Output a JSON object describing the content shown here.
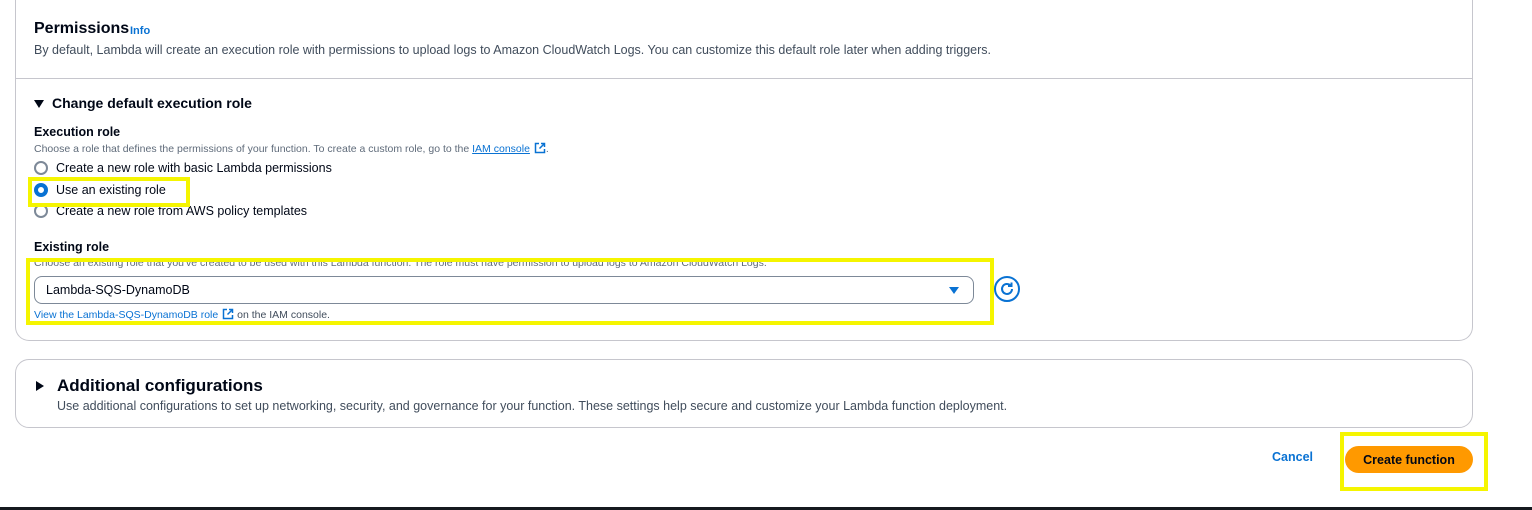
{
  "permissions": {
    "title": "Permissions",
    "info_link": "Info",
    "description": "By default, Lambda will create an execution role with permissions to upload logs to Amazon CloudWatch Logs. You can customize this default role later when adding triggers."
  },
  "execution_role_section": {
    "toggle_label": "Change default execution role",
    "execution_role": {
      "label": "Execution role",
      "description_prefix": "Choose a role that defines the permissions of your function. To create a custom role, go to the",
      "iam_console_link": "IAM console",
      "description_suffix": ".",
      "options": [
        {
          "label": "Create a new role with basic Lambda permissions",
          "checked": false
        },
        {
          "label": "Use an existing role",
          "checked": true
        },
        {
          "label": "Create a new role from AWS policy templates",
          "checked": false
        }
      ]
    },
    "existing_role": {
      "label": "Existing role",
      "description": "Choose an existing role that you've created to be used with this Lambda function. The role must have permission to upload logs to Amazon CloudWatch Logs.",
      "selected_value": "Lambda-SQS-DynamoDB",
      "view_link": "View the Lambda-SQS-DynamoDB role",
      "view_suffix": "on the IAM console."
    }
  },
  "additional_configurations": {
    "title": "Additional configurations",
    "description": "Use additional configurations to set up networking, security, and governance for your function. These settings help secure and customize your Lambda function deployment."
  },
  "footer": {
    "cancel_label": "Cancel",
    "create_label": "Create function"
  },
  "colors": {
    "link": "#0972d3",
    "primary_button": "#ff9900",
    "highlight": "#f5f500"
  }
}
